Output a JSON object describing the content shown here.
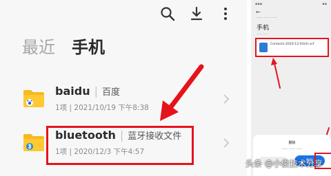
{
  "toolbar": {
    "icons": [
      "search-icon",
      "download-icon",
      "more-vert-icon"
    ]
  },
  "tabs": {
    "recent": "最近",
    "phone": "手机"
  },
  "rows": [
    {
      "name": "baidu",
      "desc": "百度",
      "meta": "1项 | 2021/10/19 下午8:38"
    },
    {
      "name": "bluetooth",
      "desc": "蓝牙接收文件",
      "meta": "1项 | 2020/12/3 下午4:57"
    }
  ],
  "row_separator": "|",
  "colors": {
    "highlight": "#e5131c",
    "folder": "#f6b91f",
    "accent_blue": "#1a73e8"
  },
  "phone": {
    "back": "←",
    "title": "手机",
    "file_name": "Contacts-2020-12-03(4).vcf",
    "dialog": {
      "title": "删除",
      "delete_button": "删除"
    }
  },
  "watermark": "头条 @小俊技术分享"
}
